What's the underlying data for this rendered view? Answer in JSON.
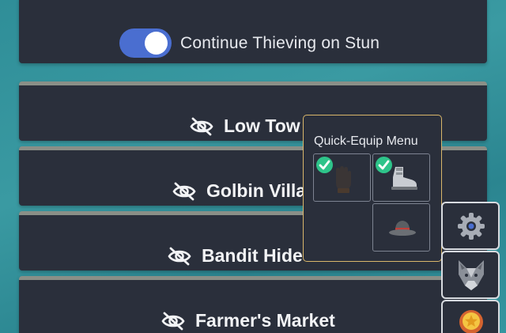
{
  "settings": {
    "continue_thieving_label": "Continue Thieving on Stun",
    "continue_thieving_on": true
  },
  "areas": [
    {
      "name": "Low Town",
      "visible_text": "Low Tow",
      "icon": "eye-slash-icon"
    },
    {
      "name": "Golbin Village",
      "visible_text": "Golbin Villa",
      "icon": "eye-slash-icon"
    },
    {
      "name": "Bandit Hideout",
      "visible_text": "Bandit Hide",
      "icon": "eye-slash-icon"
    },
    {
      "name": "Farmer's Market",
      "visible_text": "Farmer's Market",
      "icon": "eye-slash-icon"
    }
  ],
  "quick_equip": {
    "title": "Quick-Equip Menu",
    "slots": [
      {
        "item": "gloves-icon",
        "equipped": true
      },
      {
        "item": "boots-icon",
        "equipped": true
      },
      {
        "item": "hat-icon",
        "equipped": false
      }
    ]
  },
  "side_buttons": [
    {
      "icon": "gear-icon"
    },
    {
      "icon": "wolf-icon"
    },
    {
      "icon": "medal-icon"
    }
  ],
  "colors": {
    "panel": "#2a2f3b",
    "toggle_on": "#4a6ed0",
    "check": "#2ec48a",
    "popup_border": "#d9b66a"
  }
}
